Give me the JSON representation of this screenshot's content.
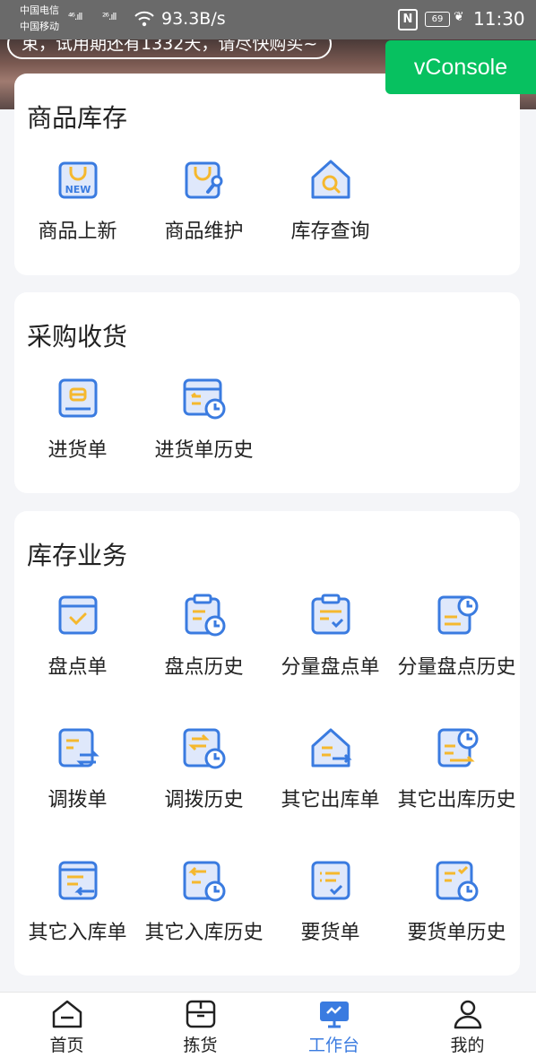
{
  "status_bar": {
    "carrier1": "中国电信",
    "carrier2": "中国移动",
    "signal1": "⁴⁶.ıll",
    "signal2": "²⁶.ıll",
    "net_speed": "93.3B/s",
    "nfc": "N",
    "battery": "69",
    "time": "11:30"
  },
  "banner": {
    "notice": "束，试用期还有1332天，请尽快购买~"
  },
  "vconsole": "vConsole",
  "sections": [
    {
      "title": "商品库存",
      "items": [
        {
          "label": "商品上新",
          "icon": "bag-new-icon"
        },
        {
          "label": "商品维护",
          "icon": "bag-wrench-icon"
        },
        {
          "label": "库存查询",
          "icon": "house-search-icon"
        }
      ]
    },
    {
      "title": "采购收货",
      "items": [
        {
          "label": "进货单",
          "icon": "box-doc-icon"
        },
        {
          "label": "进货单历史",
          "icon": "box-history-icon"
        }
      ]
    },
    {
      "title": "库存业务",
      "items": [
        {
          "label": "盘点单",
          "icon": "tray-check-icon"
        },
        {
          "label": "盘点历史",
          "icon": "clipboard-clock-icon"
        },
        {
          "label": "分量盘点单",
          "icon": "clipboard-check-icon"
        },
        {
          "label": "分量盘点历史",
          "icon": "doc-clock-icon"
        },
        {
          "label": "调拨单",
          "icon": "doc-transfer-icon"
        },
        {
          "label": "调拨历史",
          "icon": "transfer-clock-icon"
        },
        {
          "label": "其它出库单",
          "icon": "house-out-icon"
        },
        {
          "label": "其它出库历史",
          "icon": "doc-out-clock-icon"
        },
        {
          "label": "其它入库单",
          "icon": "list-in-icon"
        },
        {
          "label": "其它入库历史",
          "icon": "in-clock-icon"
        },
        {
          "label": "要货单",
          "icon": "list-check-icon"
        },
        {
          "label": "要货单历史",
          "icon": "check-clock-icon"
        }
      ]
    }
  ],
  "tabbar": [
    {
      "label": "首页",
      "icon": "home-icon",
      "active": false
    },
    {
      "label": "拣货",
      "icon": "package-icon",
      "active": false
    },
    {
      "label": "工作台",
      "icon": "monitor-icon",
      "active": true
    },
    {
      "label": "我的",
      "icon": "user-icon",
      "active": false
    }
  ],
  "colors": {
    "accent_blue": "#3a7be0",
    "icon_orange": "#f5b82e",
    "icon_fill": "#dfe8fb",
    "vconsole_green": "#07c160"
  }
}
